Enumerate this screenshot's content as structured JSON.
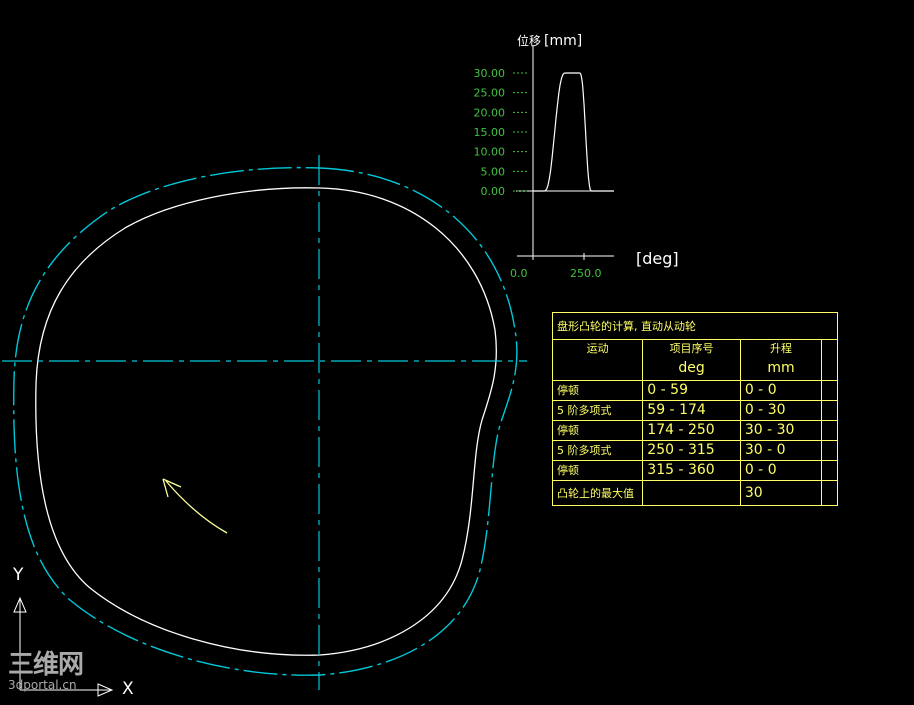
{
  "graph": {
    "ylabel_text": "位移",
    "ylabel_unit": "[mm]",
    "y_ticks": [
      "30.00",
      "25.00",
      "20.00",
      "15.00",
      "10.00",
      "5.00",
      "0.00"
    ],
    "x_ticks": [
      "0.0",
      "250.0"
    ],
    "xlabel": "[deg]"
  },
  "chart_data": {
    "type": "line",
    "xlabel": "[deg]",
    "ylabel": "位移 [mm]",
    "ylim": [
      0,
      30
    ],
    "x": [
      0,
      59,
      174,
      250,
      315,
      360
    ],
    "series": [
      {
        "values": [
          0,
          0,
          30,
          30,
          0,
          0
        ]
      }
    ]
  },
  "table": {
    "title": "盘形凸轮的计算, 直动从动轮",
    "headers": [
      {
        "label": "运动",
        "unit": ""
      },
      {
        "label": "项目序号",
        "unit": "deg"
      },
      {
        "label": "升程",
        "unit": "mm"
      }
    ],
    "rows": [
      {
        "motion": "停顿",
        "range": "0 - 59",
        "lift": "0 - 0"
      },
      {
        "motion": "5 阶多项式",
        "range": "59 - 174",
        "lift": "0 - 30"
      },
      {
        "motion": "停顿",
        "range": "174 - 250",
        "lift": "30 - 30"
      },
      {
        "motion": "5 阶多项式",
        "range": "250 - 315",
        "lift": "30 - 0"
      },
      {
        "motion": "停顿",
        "range": "315 - 360",
        "lift": "0 - 0"
      }
    ],
    "max_label": "凸轮上的最大值",
    "max_value": "30"
  },
  "ucs": {
    "y": "Y",
    "x": "X"
  },
  "watermark": {
    "main": "三维网",
    "sub": "3dportal.cn"
  },
  "colors": {
    "background": "#000000",
    "cam_profile": "#ffffff",
    "pitch_curve": "#00c8d8",
    "center_lines": "#00c8d8",
    "graph": "#40c040",
    "graph_axis": "#ffffff",
    "table": "#ffff66"
  }
}
